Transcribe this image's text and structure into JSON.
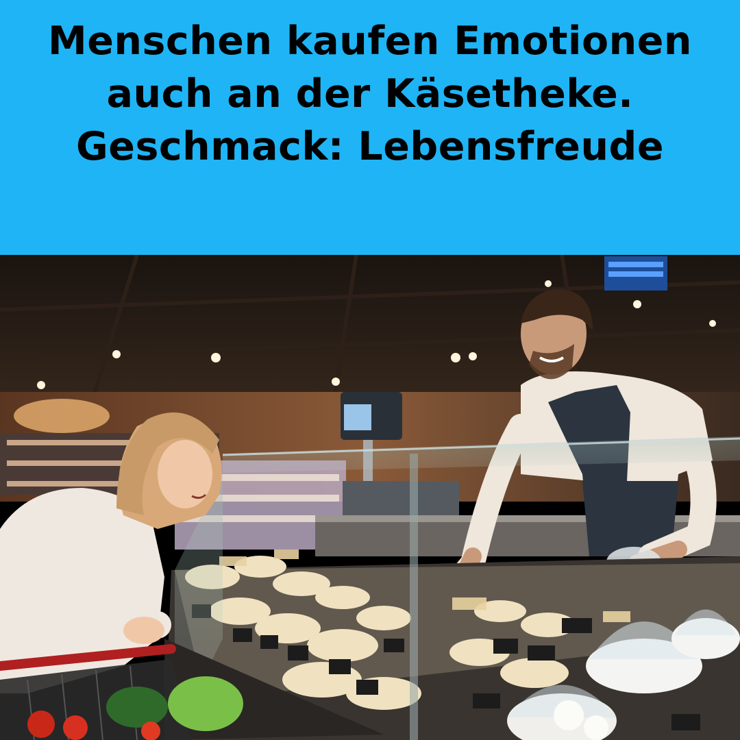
{
  "banner": {
    "background_color": "#1fb4f5",
    "text_color": "#000000",
    "lines": [
      "Menschen kaufen Emotionen",
      "auch an der Käsetheke.",
      "Geschmack: Lebensfreude"
    ]
  },
  "photo": {
    "scene": "cheese-counter"
  }
}
